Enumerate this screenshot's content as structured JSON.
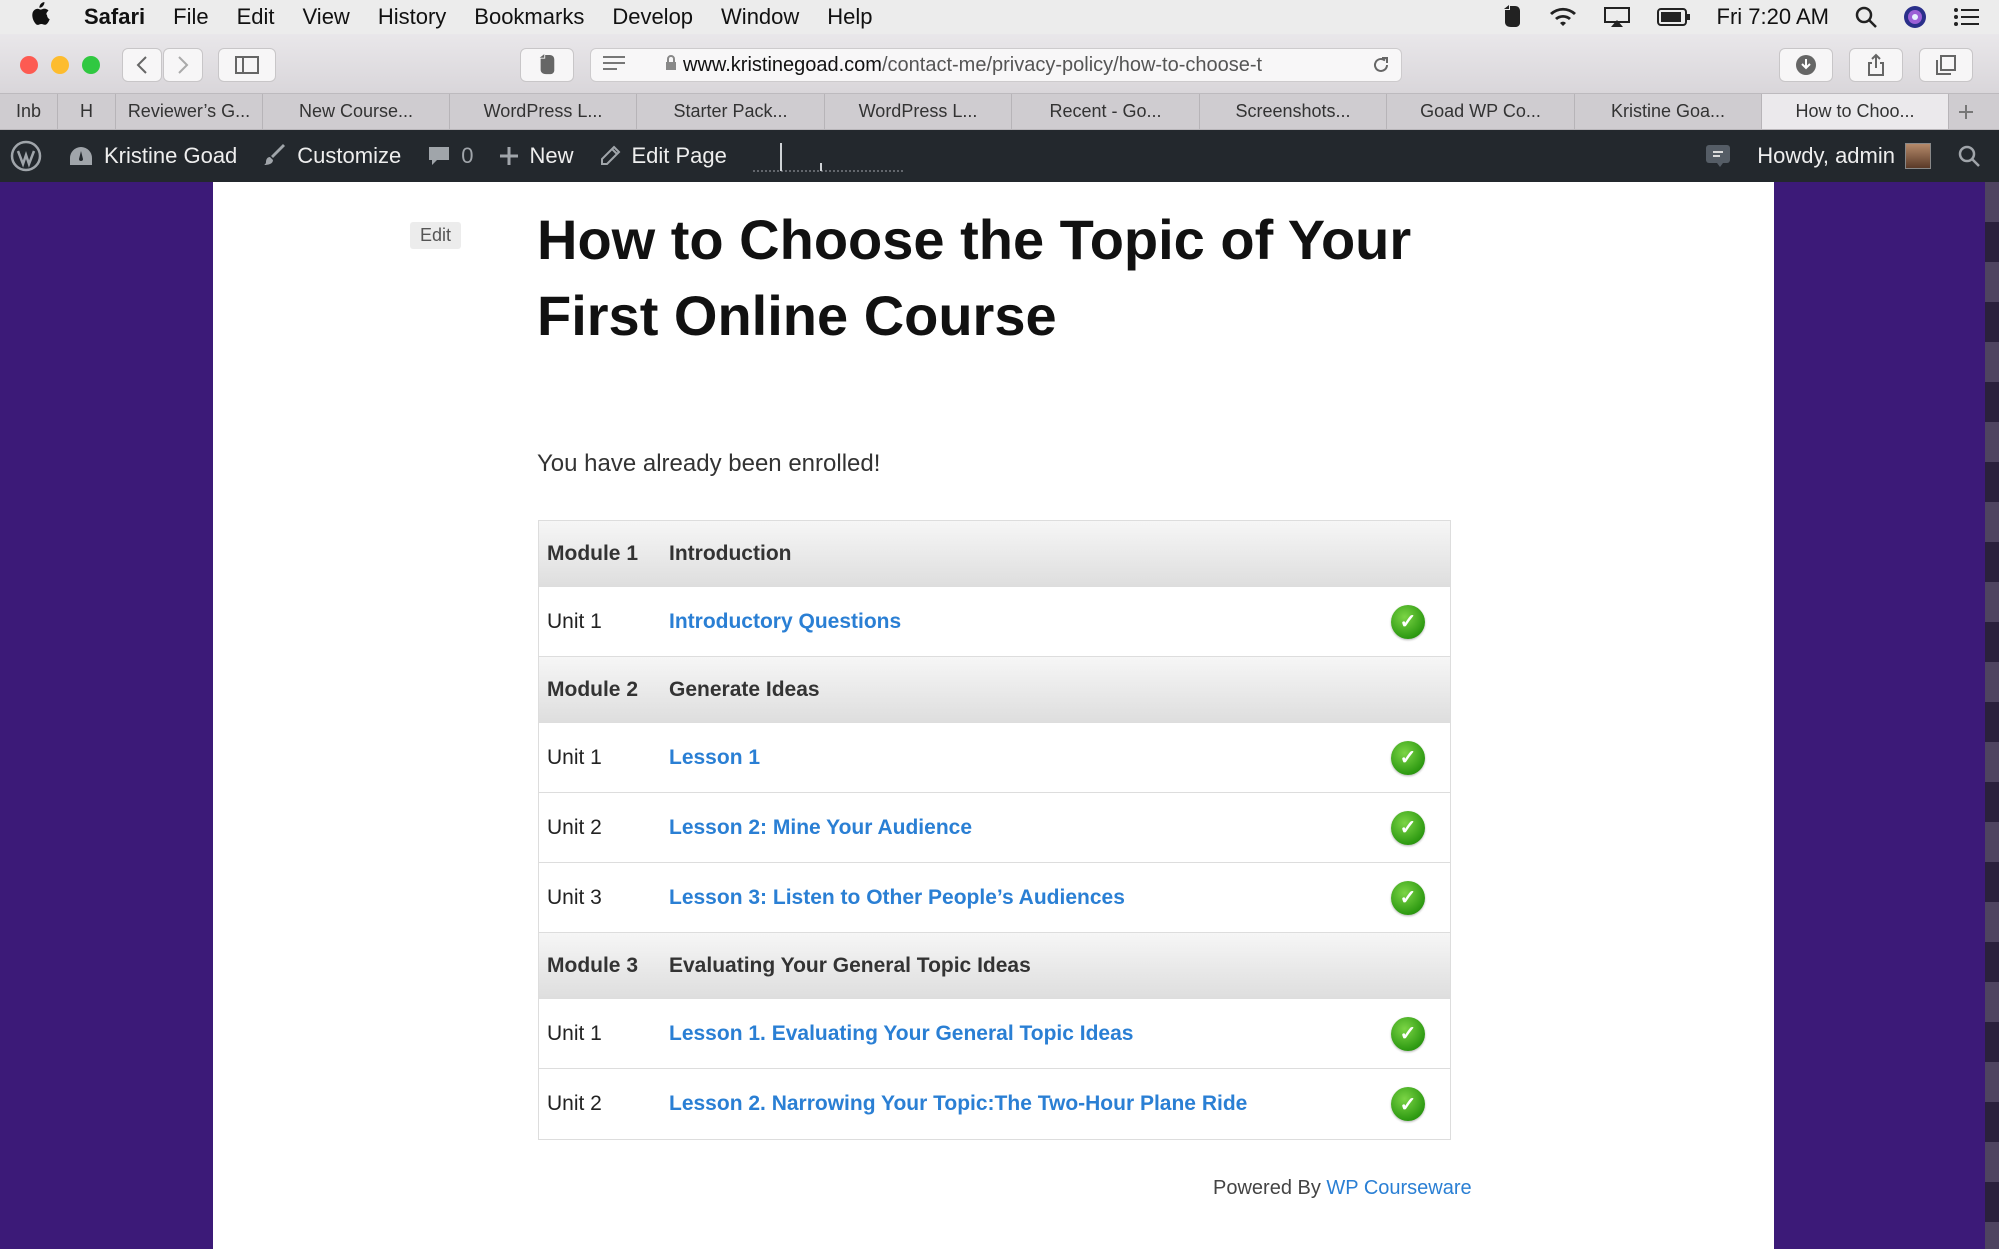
{
  "menubar": {
    "app": "Safari",
    "items": [
      "File",
      "Edit",
      "View",
      "History",
      "Bookmarks",
      "Develop",
      "Window",
      "Help"
    ],
    "clock": "Fri 7:20 AM"
  },
  "browser": {
    "url_host": "www.kristinegoad.com",
    "url_path": "/contact-me/privacy-policy/how-to-choose-t",
    "tabs": [
      "Inb",
      "H",
      "Reviewer’s G...",
      "New Course...",
      "WordPress L...",
      "Starter Pack...",
      "WordPress L...",
      "Recent - Go...",
      "Screenshots...",
      "Goad WP Co...",
      "Kristine Goa...",
      "How to Choo..."
    ]
  },
  "adminbar": {
    "site_name": "Kristine Goad",
    "customize": "Customize",
    "comments_count": "0",
    "new": "New",
    "edit_page": "Edit Page",
    "howdy": "Howdy, admin"
  },
  "page": {
    "edit_label": "Edit",
    "title": "How to Choose the Topic of Your First Online Course",
    "enrolled": "You have already been enrolled!",
    "modules": [
      {
        "label": "Module 1",
        "name": "Introduction",
        "units": [
          {
            "label": "Unit 1",
            "title": "Introductory Questions"
          }
        ]
      },
      {
        "label": "Module 2",
        "name": "Generate Ideas",
        "units": [
          {
            "label": "Unit 1",
            "title": "Lesson 1"
          },
          {
            "label": "Unit 2",
            "title": "Lesson 2: Mine Your Audience"
          },
          {
            "label": "Unit 3",
            "title": "Lesson 3: Listen to Other People’s Audiences"
          }
        ]
      },
      {
        "label": "Module 3",
        "name": "Evaluating Your General Topic Ideas",
        "units": [
          {
            "label": "Unit 1",
            "title": "Lesson 1. Evaluating Your General Topic Ideas"
          },
          {
            "label": "Unit 2",
            "title": "Lesson 2. Narrowing Your Topic:The Two-Hour Plane Ride"
          }
        ]
      }
    ],
    "powered_by": "Powered By",
    "powered_link": "WP Courseware"
  },
  "colors": {
    "background": "#3c1a78",
    "link": "#2a7fd4",
    "adminbar": "#23282d",
    "check": "#2e9a12"
  }
}
